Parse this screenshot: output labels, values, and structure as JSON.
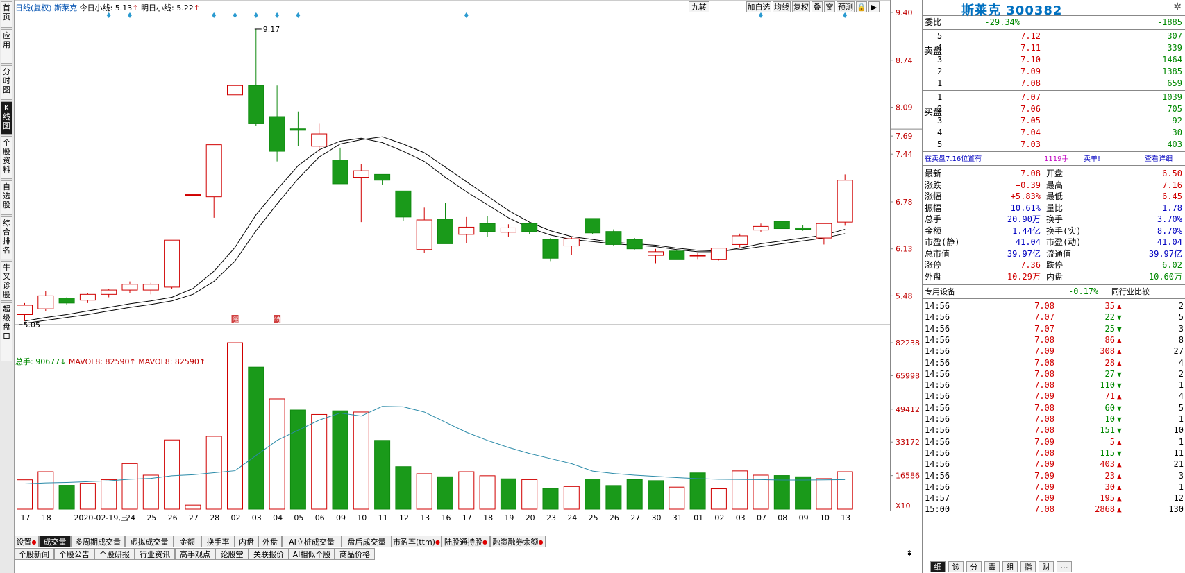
{
  "sidebar": [
    {
      "label": "首页",
      "active": false
    },
    {
      "label": "应用",
      "active": false
    },
    {
      "label": "分时图",
      "active": false
    },
    {
      "label": "K线图",
      "active": true
    },
    {
      "label": "个股资料",
      "active": false
    },
    {
      "label": "自选股",
      "active": false
    },
    {
      "label": "综合排名",
      "active": false
    },
    {
      "label": "牛叉诊股",
      "active": false
    },
    {
      "label": "超级盘口",
      "active": false
    }
  ],
  "chart_header": {
    "period": "日线(复权)",
    "stock": "斯莱克",
    "today_label": "今日小线: 5.13",
    "tomorrow_label": "明日小线: 5.22",
    "arrow": "↑"
  },
  "toolbar": {
    "jiuzhuan": "九转",
    "buttons": [
      "加自选",
      "均线",
      "复权",
      "叠",
      "窗",
      "预测",
      "🔒",
      "▶"
    ]
  },
  "volume_header": {
    "total": "总手: 90677",
    "mavol1": "MAVOL8: 82590",
    "mavol2": "MAVOL8: 82590",
    "down": "↓",
    "up": "↑"
  },
  "annotations": {
    "high": "9.17",
    "low": "5.05",
    "zhang": "涨",
    "te": "特"
  },
  "x_labels": [
    "17",
    "18",
    "2020-02-19,三",
    "24",
    "25",
    "26",
    "27",
    "28",
    "02",
    "03",
    "04",
    "05",
    "06",
    "09",
    "10",
    "11",
    "12",
    "13",
    "16",
    "17",
    "18",
    "19",
    "20",
    "23",
    "24",
    "25",
    "26",
    "27",
    "30",
    "31",
    "01",
    "02",
    "03",
    "07",
    "08",
    "09",
    "10",
    "13"
  ],
  "price_ticks": [
    "9.40",
    "8.74",
    "8.09",
    "7.69",
    "7.44",
    "6.78",
    "6.13",
    "5.48"
  ],
  "vol_ticks": [
    "82238",
    "65998",
    "49412",
    "33172",
    "16586",
    "X10"
  ],
  "chart_data": [
    {
      "type": "candlestick",
      "ylim": [
        5.1,
        9.4
      ],
      "candles": [
        [
          5.22,
          5.35,
          5.13,
          5.38
        ],
        [
          5.3,
          5.48,
          5.27,
          5.55
        ],
        [
          5.45,
          5.38,
          5.36,
          5.46
        ],
        [
          5.42,
          5.5,
          5.38,
          5.52
        ],
        [
          5.5,
          5.56,
          5.46,
          5.58
        ],
        [
          5.56,
          5.64,
          5.52,
          5.68
        ],
        [
          5.56,
          5.64,
          5.5,
          5.66
        ],
        [
          5.6,
          6.25,
          5.58,
          6.25
        ],
        [
          6.88,
          6.88,
          6.88,
          6.88
        ],
        [
          6.85,
          7.57,
          6.56,
          7.57
        ],
        [
          8.26,
          8.39,
          8.05,
          8.39
        ],
        [
          8.39,
          7.86,
          7.83,
          9.17
        ],
        [
          7.96,
          7.48,
          7.34,
          8.39
        ],
        [
          7.79,
          7.77,
          7.55,
          8.03
        ],
        [
          7.55,
          7.72,
          7.47,
          7.86
        ],
        [
          7.36,
          7.03,
          7.03,
          7.53
        ],
        [
          7.12,
          7.21,
          6.5,
          7.3
        ],
        [
          7.16,
          7.08,
          7.02,
          7.16
        ],
        [
          6.93,
          6.57,
          6.52,
          6.93
        ],
        [
          6.12,
          6.53,
          6.07,
          6.7
        ],
        [
          6.54,
          6.2,
          6.2,
          6.76
        ],
        [
          6.33,
          6.43,
          6.21,
          6.57
        ],
        [
          6.48,
          6.37,
          6.3,
          6.58
        ],
        [
          6.36,
          6.42,
          6.3,
          6.47
        ],
        [
          6.48,
          6.37,
          6.33,
          6.5
        ],
        [
          6.26,
          6.0,
          5.96,
          6.28
        ],
        [
          6.17,
          6.27,
          6.05,
          6.29
        ],
        [
          6.55,
          6.35,
          6.33,
          6.55
        ],
        [
          6.37,
          6.19,
          6.17,
          6.4
        ],
        [
          6.26,
          6.13,
          6.12,
          6.28
        ],
        [
          6.04,
          6.09,
          5.93,
          6.13
        ],
        [
          6.1,
          5.98,
          5.98,
          6.11
        ],
        [
          6.04,
          6.04,
          5.98,
          6.08
        ],
        [
          5.98,
          6.14,
          5.97,
          6.14
        ],
        [
          6.19,
          6.31,
          6.15,
          6.34
        ],
        [
          6.39,
          6.44,
          6.36,
          6.48
        ],
        [
          6.51,
          6.41,
          6.41,
          6.51
        ],
        [
          6.42,
          6.4,
          6.38,
          6.46
        ],
        [
          6.28,
          6.48,
          6.19,
          6.48
        ],
        [
          6.5,
          7.08,
          6.45,
          7.16
        ]
      ],
      "ma1": [
        5.13,
        5.18,
        5.22,
        5.27,
        5.32,
        5.37,
        5.41,
        5.46,
        5.58,
        5.82,
        6.15,
        6.6,
        6.95,
        7.28,
        7.5,
        7.62,
        7.66,
        7.6,
        7.48,
        7.34,
        7.12,
        6.92,
        6.74,
        6.56,
        6.42,
        6.32,
        6.26,
        6.23,
        6.2,
        6.18,
        6.16,
        6.12,
        6.09,
        6.09,
        6.14,
        6.2,
        6.24,
        6.28,
        6.32,
        6.4
      ],
      "ma2": [
        5.1,
        5.14,
        5.18,
        5.22,
        5.27,
        5.32,
        5.36,
        5.41,
        5.5,
        5.68,
        5.96,
        6.38,
        6.75,
        7.1,
        7.4,
        7.58,
        7.64,
        7.68,
        7.58,
        7.46,
        7.26,
        7.06,
        6.86,
        6.66,
        6.5,
        6.38,
        6.3,
        6.26,
        6.22,
        6.2,
        6.18,
        6.14,
        6.11,
        6.1,
        6.12,
        6.16,
        6.2,
        6.24,
        6.28,
        6.34
      ],
      "diamonds": [
        4,
        5,
        9,
        10,
        11,
        12,
        13,
        21,
        35,
        39
      ]
    },
    {
      "type": "bar",
      "ylim": [
        0,
        85000
      ],
      "volumes": [
        14500,
        18500,
        11800,
        12800,
        14600,
        22500,
        16800,
        34200,
        2000,
        36000,
        82238,
        70200,
        54500,
        49000,
        46800,
        48600,
        48000,
        34000,
        21000,
        17500,
        16000,
        18500,
        16500,
        15000,
        14600,
        10300,
        11200,
        14900,
        11700,
        14600,
        14100,
        10900,
        17900,
        10100,
        18900,
        16800,
        16600,
        16000,
        15100,
        18500,
        24500
      ],
      "vol_up": [
        true,
        true,
        false,
        true,
        true,
        true,
        true,
        true,
        true,
        true,
        true,
        false,
        true,
        false,
        true,
        false,
        true,
        false,
        false,
        true,
        false,
        true,
        true,
        false,
        true,
        false,
        true,
        false,
        false,
        false,
        false,
        true,
        false,
        true,
        true,
        true,
        false,
        false,
        true,
        true
      ],
      "mavol": [
        12500,
        13000,
        13200,
        13600,
        14000,
        14800,
        15200,
        16500,
        17000,
        18000,
        19000,
        26500,
        34000,
        39000,
        44000,
        47500,
        46000,
        50800,
        50600,
        48000,
        43000,
        38000,
        34000,
        30500,
        27500,
        25000,
        22500,
        18800,
        17600,
        16800,
        16200,
        15600,
        15100,
        14800,
        14700,
        14600,
        14400,
        14400,
        14500,
        14600,
        14800,
        15400,
        16500
      ]
    }
  ],
  "right_panel": {
    "title": "斯莱克  300382",
    "weibi": {
      "label": "委比",
      "pct": "-29.34%",
      "val": "-1885"
    },
    "sell_label": "卖盘",
    "buy_label": "买盘",
    "sells": [
      [
        "5",
        "7.12",
        "307"
      ],
      [
        "4",
        "7.11",
        "339"
      ],
      [
        "3",
        "7.10",
        "1464"
      ],
      [
        "2",
        "7.09",
        "1385"
      ],
      [
        "1",
        "7.08",
        "659"
      ]
    ],
    "buys": [
      [
        "1",
        "7.07",
        "1039"
      ],
      [
        "2",
        "7.06",
        "705"
      ],
      [
        "3",
        "7.05",
        "92"
      ],
      [
        "4",
        "7.04",
        "30"
      ],
      [
        "5",
        "7.03",
        "403"
      ]
    ],
    "notice": {
      "a": "在卖盘7.16位置有",
      "b": "1119手",
      "c": "卖单!",
      "d": "查看详细"
    },
    "quote": [
      [
        "最新",
        "7.08",
        "开盘",
        "6.50"
      ],
      [
        "涨跌",
        "+0.39",
        "最高",
        "7.16"
      ],
      [
        "涨幅",
        "+5.83%",
        "最低",
        "6.45"
      ],
      [
        "振幅",
        "10.61%",
        "量比",
        "1.78"
      ],
      [
        "总手",
        "20.90万",
        "换手",
        "3.70%"
      ],
      [
        "金额",
        "1.44亿",
        "换手(实)",
        "8.70%"
      ],
      [
        "市盈(静)",
        "41.04",
        "市盈(动)",
        "41.04"
      ],
      [
        "总市值",
        "39.97亿",
        "流通值",
        "39.97亿"
      ],
      [
        "涨停",
        "7.36",
        "跌停",
        "6.02"
      ],
      [
        "外盘",
        "10.29万",
        "内盘",
        "10.60万"
      ]
    ],
    "industry": {
      "name": "专用设备",
      "pct": "-0.17%",
      "compare": "同行业比较"
    },
    "ticks": [
      [
        "14:56",
        "7.08",
        "35",
        "up",
        "2"
      ],
      [
        "14:56",
        "7.07",
        "22",
        "down",
        "5"
      ],
      [
        "14:56",
        "7.07",
        "25",
        "down",
        "3"
      ],
      [
        "14:56",
        "7.08",
        "86",
        "up",
        "8"
      ],
      [
        "14:56",
        "7.09",
        "308",
        "up",
        "27"
      ],
      [
        "14:56",
        "7.08",
        "28",
        "up",
        "4"
      ],
      [
        "14:56",
        "7.08",
        "27",
        "down",
        "2"
      ],
      [
        "14:56",
        "7.08",
        "110",
        "down",
        "1"
      ],
      [
        "14:56",
        "7.09",
        "71",
        "up",
        "4"
      ],
      [
        "14:56",
        "7.08",
        "60",
        "down",
        "5"
      ],
      [
        "14:56",
        "7.08",
        "10",
        "down",
        "1"
      ],
      [
        "14:56",
        "7.08",
        "151",
        "down",
        "10"
      ],
      [
        "14:56",
        "7.09",
        "5",
        "up",
        "1"
      ],
      [
        "14:56",
        "7.08",
        "115",
        "down",
        "11"
      ],
      [
        "14:56",
        "7.09",
        "403",
        "up",
        "21"
      ],
      [
        "14:56",
        "7.09",
        "23",
        "up",
        "3"
      ],
      [
        "14:56",
        "7.09",
        "30",
        "up",
        "1"
      ],
      [
        "14:57",
        "7.09",
        "195",
        "up",
        "12"
      ],
      [
        "15:00",
        "7.08",
        "2868",
        "up",
        "130"
      ]
    ],
    "bottom_tabs": [
      "细",
      "诊",
      "分",
      "毒",
      "组",
      "指",
      "财",
      "⋯"
    ]
  },
  "indicator_tabs": [
    "设置",
    "成交量",
    "多周期成交量",
    "虚拟成交量",
    "金额",
    "换手率",
    "内盘",
    "外盘",
    "AI立桩成交量",
    "盘后成交量",
    "市盈率(ttm)",
    "陆股通持股",
    "融资融券余额"
  ],
  "news_tabs": [
    "个股新闻",
    "个股公告",
    "个股研报",
    "行业资讯",
    "高手观点",
    "论股堂",
    "关联报价",
    "AI相似个股",
    "商品价格"
  ]
}
